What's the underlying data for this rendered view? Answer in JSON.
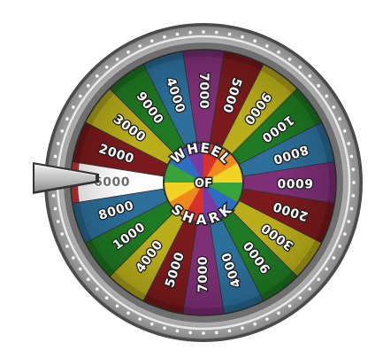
{
  "game": {
    "hub_lines": [
      "WHEEL",
      "OF",
      "SHARK"
    ],
    "pointer_icon": "pointer-arrow-icon",
    "selected_index": 0,
    "segments": [
      {
        "label": "6000",
        "color": "#ffffff"
      },
      {
        "label": "2000",
        "color": "#7a1a1c"
      },
      {
        "label": "3000",
        "color": "#b9ad1a"
      },
      {
        "label": "9000",
        "color": "#1e7a22"
      },
      {
        "label": "4000",
        "color": "#2b6f9a"
      },
      {
        "label": "7000",
        "color": "#7e2f76"
      },
      {
        "label": "5000",
        "color": "#7a1a1c"
      },
      {
        "label": "9000",
        "color": "#b9ad1a"
      },
      {
        "label": "1000",
        "color": "#1e7a22"
      },
      {
        "label": "8000",
        "color": "#2b6f9a"
      },
      {
        "label": "6000",
        "color": "#7e2f76"
      },
      {
        "label": "2000",
        "color": "#7a1a1c"
      },
      {
        "label": "3000",
        "color": "#b9ad1a"
      },
      {
        "label": "9000",
        "color": "#1e7a22"
      },
      {
        "label": "4000",
        "color": "#2b6f9a"
      },
      {
        "label": "7000",
        "color": "#7e2f76"
      },
      {
        "label": "5000",
        "color": "#7a1a1c"
      },
      {
        "label": "4000",
        "color": "#b9ad1a"
      },
      {
        "label": "1000",
        "color": "#1e7a22"
      },
      {
        "label": "8000",
        "color": "#2b6f9a"
      }
    ]
  }
}
